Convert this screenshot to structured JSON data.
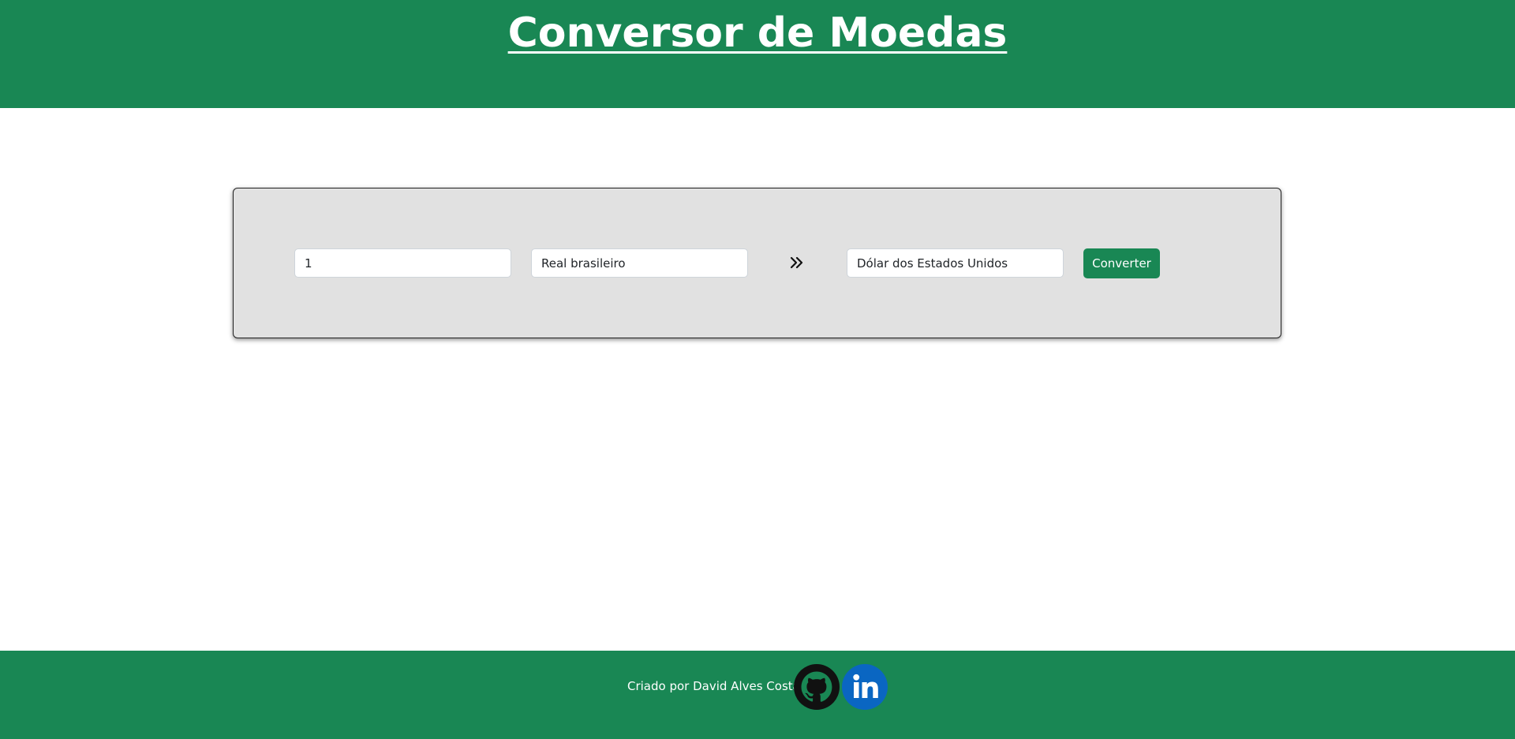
{
  "header": {
    "title": "Conversor de Moedas"
  },
  "converter": {
    "amount_value": "1",
    "from_currency": "Real brasileiro",
    "to_currency": "Dólar dos Estados Unidos",
    "arrow_icon": "double-chevron-right-icon",
    "convert_label": "Converter"
  },
  "footer": {
    "credit": "Criado por David Alves Costa",
    "github_icon": "github-icon",
    "linkedin_icon": "linkedin-icon"
  },
  "colors": {
    "brand_green": "#198754",
    "card_background": "#e1e1e1",
    "linkedin_blue": "#0a66c2"
  }
}
